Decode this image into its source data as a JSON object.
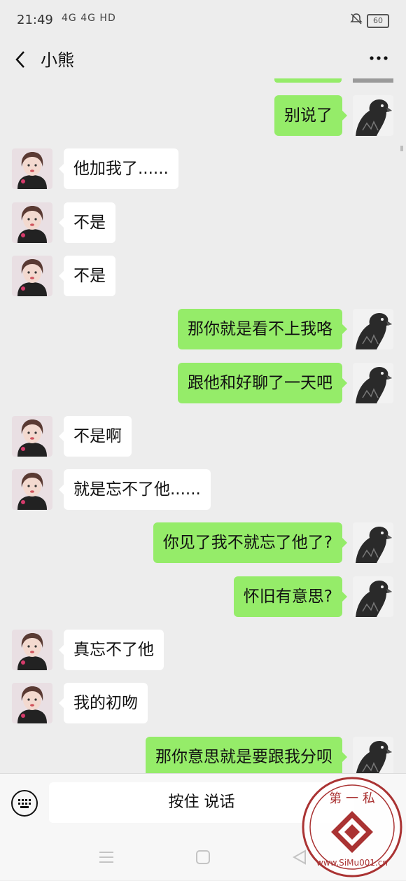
{
  "status_bar": {
    "time": "21:49",
    "network": "4G 4G HD",
    "battery": "60"
  },
  "header": {
    "title": "小熊",
    "back_icon": "chevron-left-icon",
    "more_icon": "more-dots-icon"
  },
  "messages": [
    {
      "side": "right",
      "text": "别说了"
    },
    {
      "side": "left",
      "text": "他加我了......"
    },
    {
      "side": "left",
      "text": "不是"
    },
    {
      "side": "left",
      "text": "不是"
    },
    {
      "side": "right",
      "text": "那你就是看不上我咯"
    },
    {
      "side": "right",
      "text": "跟他和好聊了一天吧"
    },
    {
      "side": "left",
      "text": "不是啊"
    },
    {
      "side": "left",
      "text": "就是忘不了他......"
    },
    {
      "side": "right",
      "text": "你见了我不就忘了他了?"
    },
    {
      "side": "right",
      "text": "怀旧有意思?"
    },
    {
      "side": "left",
      "text": "真忘不了他"
    },
    {
      "side": "left",
      "text": "我的初吻"
    },
    {
      "side": "right",
      "text": "那你意思就是要跟我分呗"
    }
  ],
  "input_bar": {
    "voice_label": "按住 说话",
    "keyboard_icon": "keyboard-icon"
  },
  "nav": {
    "icons": [
      "menu-icon",
      "home-square-icon",
      "back-triangle-icon"
    ]
  },
  "watermark": {
    "top_chars": "第一私",
    "url": "www.SiMu001.cn"
  },
  "colors": {
    "background": "#ededed",
    "sent_bubble": "#95ec69",
    "received_bubble": "#ffffff"
  }
}
